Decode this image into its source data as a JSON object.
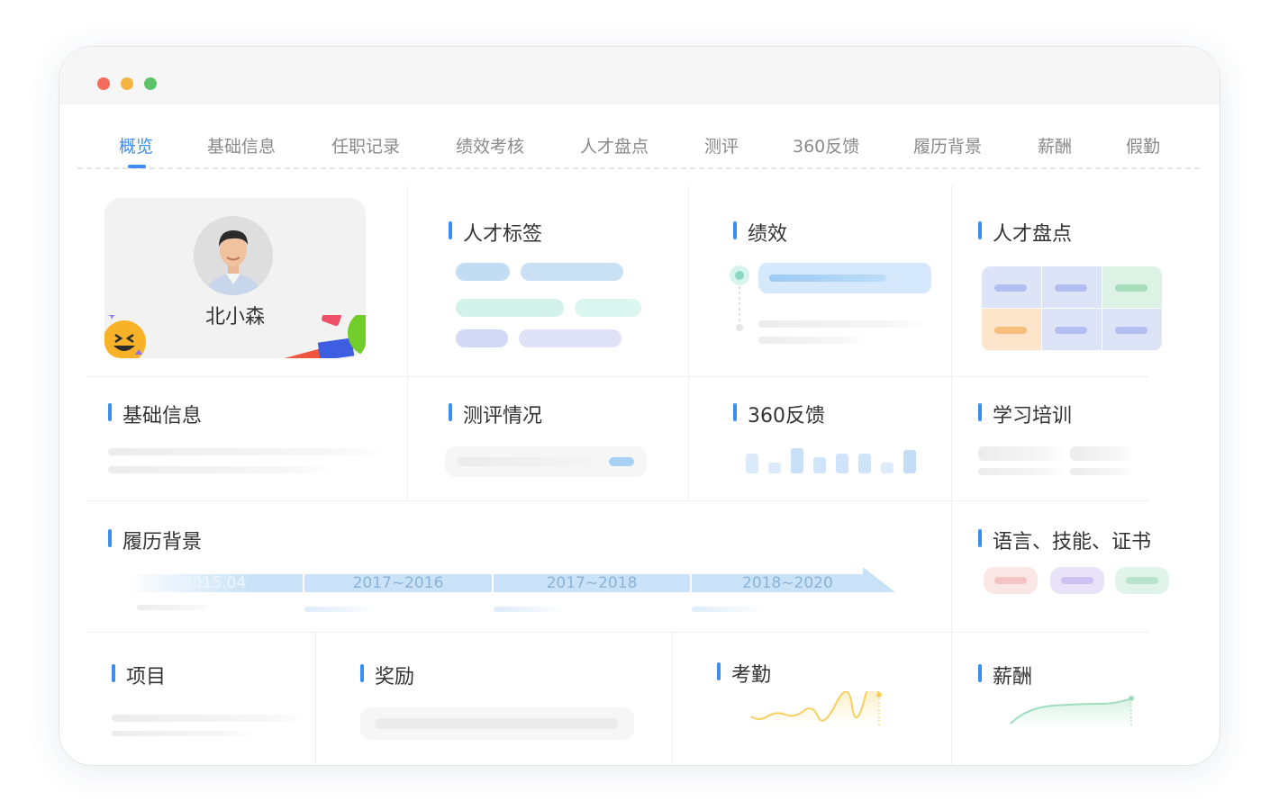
{
  "tabs": [
    {
      "label": "概览",
      "active": true
    },
    {
      "label": "基础信息"
    },
    {
      "label": "任职记录"
    },
    {
      "label": "绩效考核"
    },
    {
      "label": "人才盘点"
    },
    {
      "label": "测评"
    },
    {
      "label": "360反馈"
    },
    {
      "label": "履历背景"
    },
    {
      "label": "薪酬"
    },
    {
      "label": "假勤"
    }
  ],
  "profile": {
    "name": "北小森"
  },
  "sections": {
    "talent_tags": "人才标签",
    "performance": "绩效",
    "talent_review": "人才盘点",
    "basic_info": "基础信息",
    "assessment": "测评情况",
    "feedback_360": "360反馈",
    "training": "学习培训",
    "resume": "履历背景",
    "lang_skills": "语言、技能、证书",
    "projects": "项目",
    "rewards": "奖励",
    "attendance": "考勤",
    "salary": "薪酬"
  },
  "timeline": [
    "2015.04",
    "2017~2016",
    "2017~2018",
    "2018~2020"
  ],
  "colors": {
    "accent": "#3b8ef0",
    "dot_red": "#f26b5b",
    "dot_yellow": "#f5b342",
    "dot_green": "#5cc36a"
  }
}
